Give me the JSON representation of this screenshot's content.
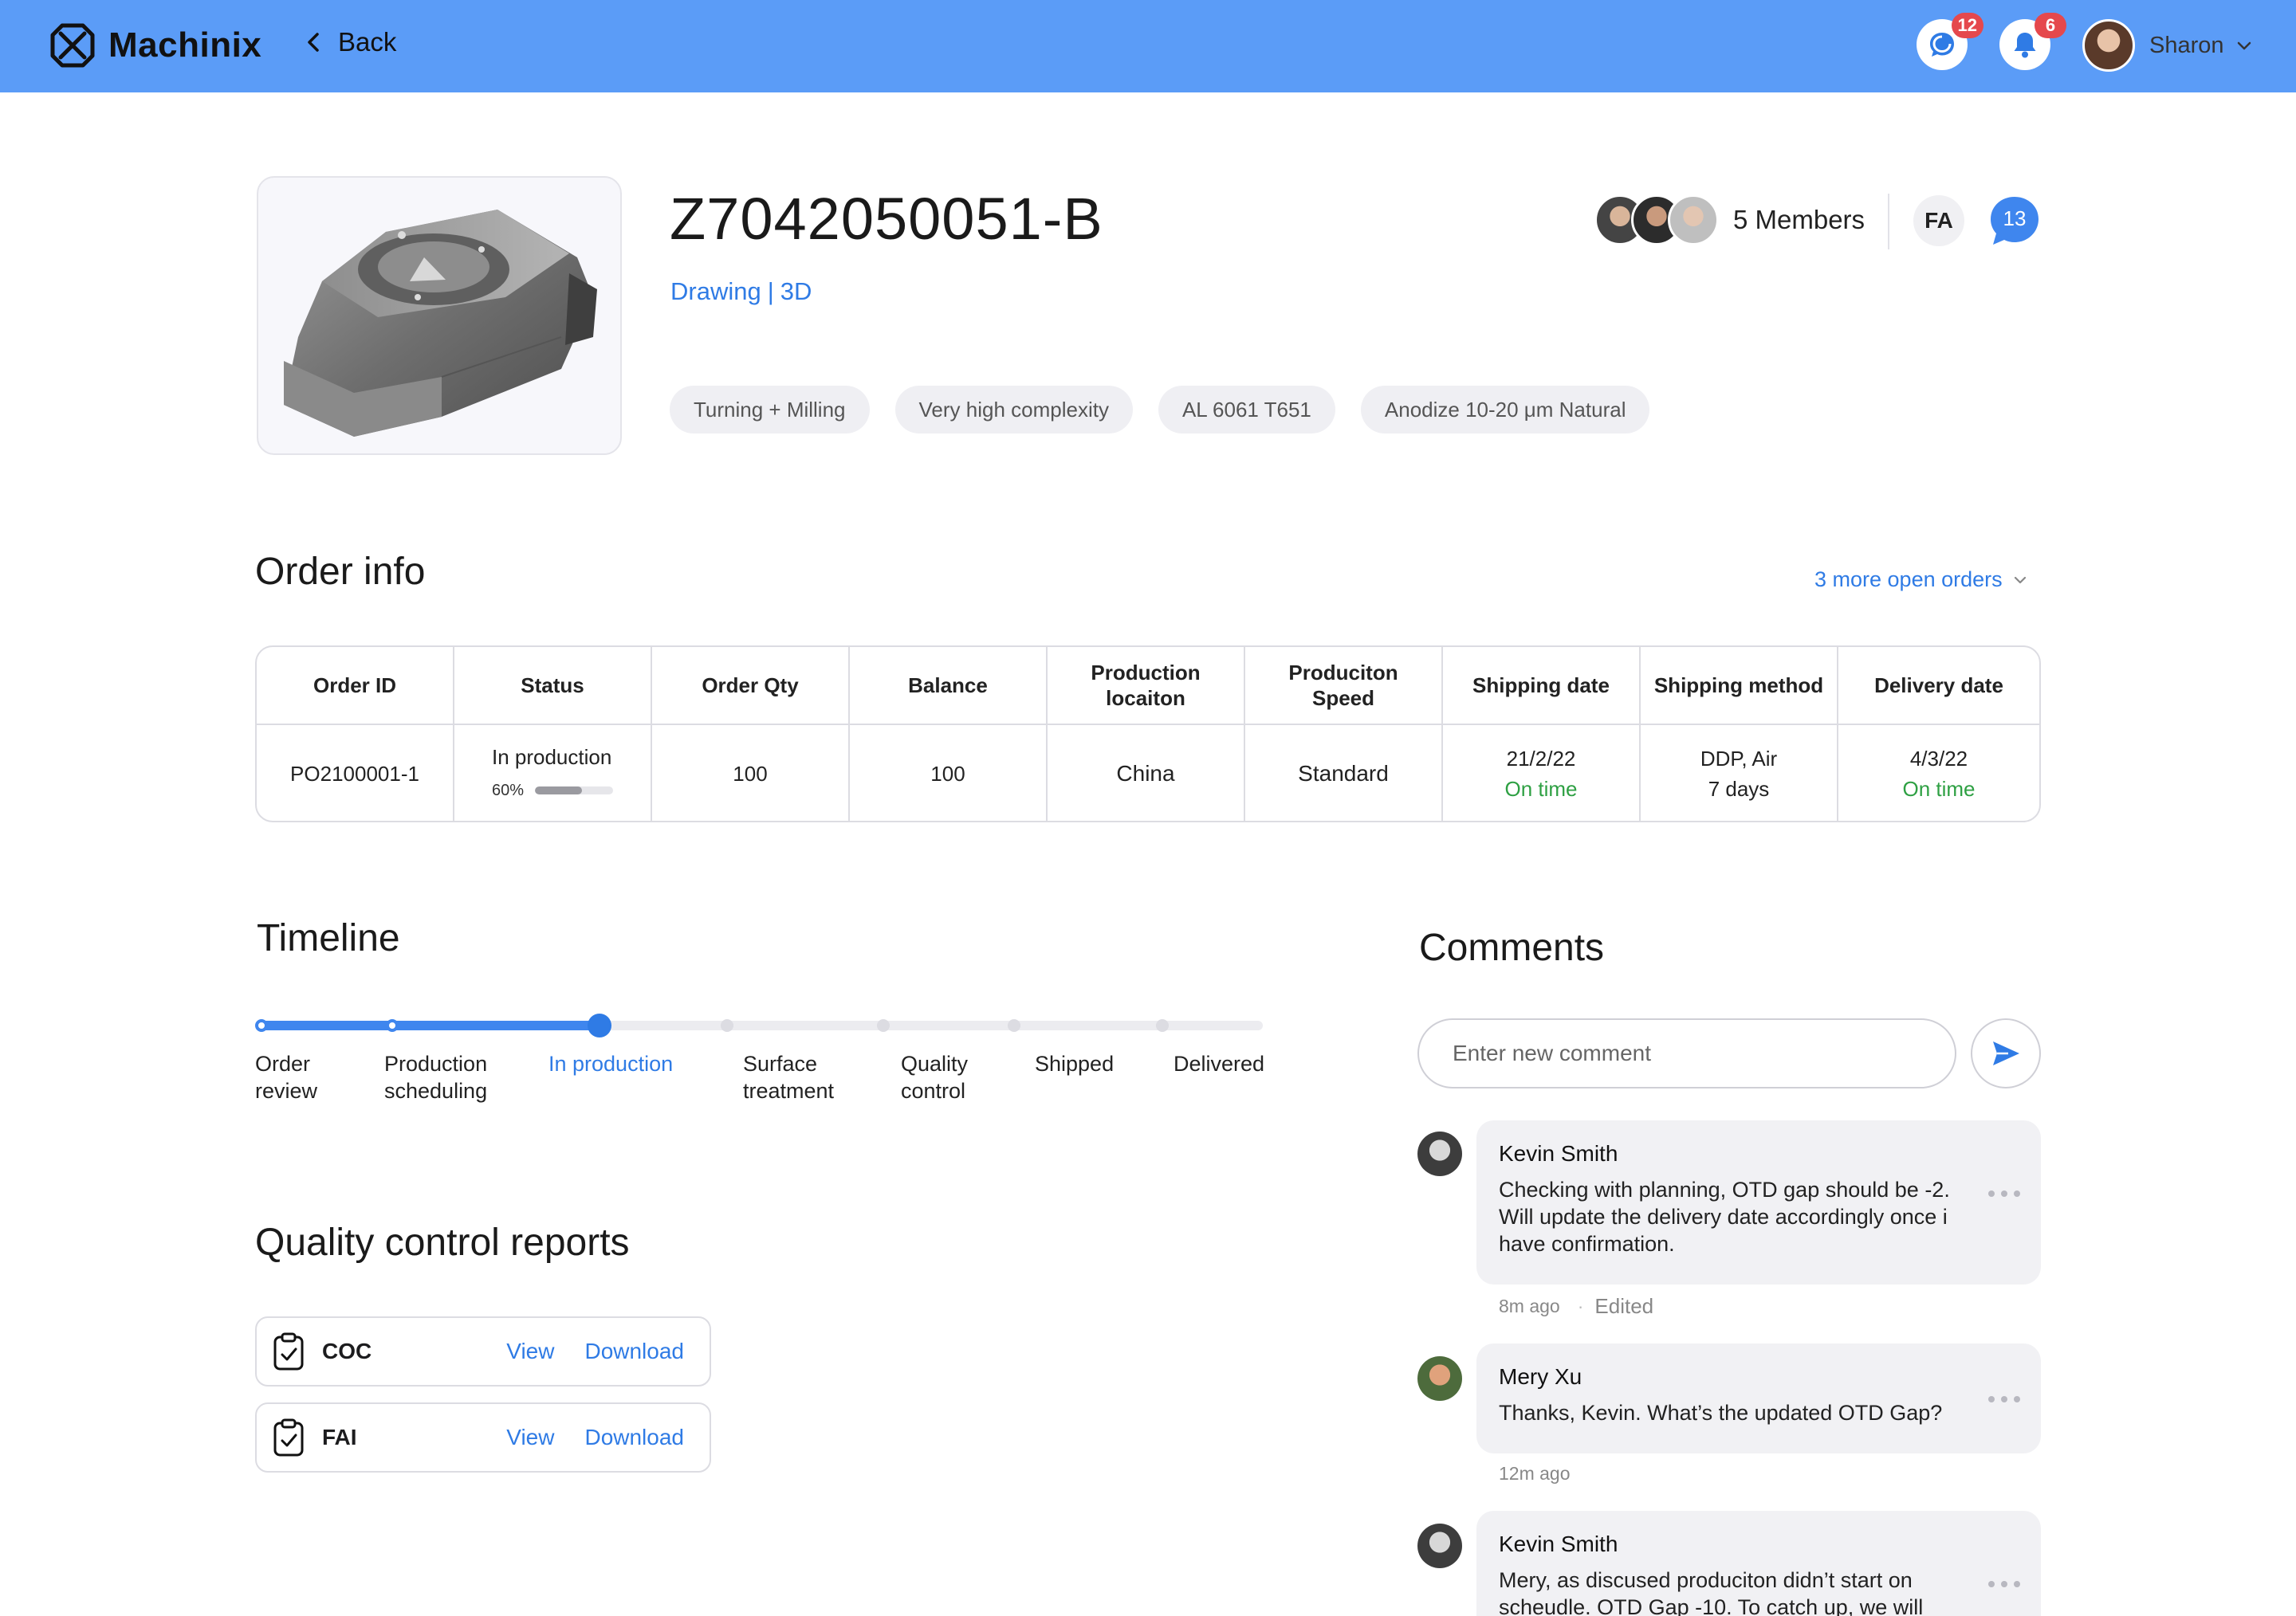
{
  "header": {
    "brand": "Machinix",
    "back_label": "Back",
    "messages_badge": "12",
    "notifications_badge": "6",
    "user_name": "Sharon",
    "brand_color": "#5b9cf7"
  },
  "part": {
    "title": "Z7042050051-B",
    "drawing_link": "Drawing",
    "link_separator": "|",
    "model_link": "3D",
    "tags": [
      "Turning + Milling",
      "Very high complexity",
      "AL 6061 T651",
      "Anodize 10-20 μm Natural"
    ],
    "members_label": "5 Members",
    "fa_label": "FA",
    "comments_count": "13"
  },
  "order_info": {
    "title": "Order info",
    "more_orders": "3 more open orders",
    "columns": [
      "Order ID",
      "Status",
      "Order Qty",
      "Balance",
      "Production\nlocaiton",
      "Produciton\nSpeed",
      "Shipping date",
      "Shipping method",
      "Delivery date"
    ],
    "row": {
      "order_id": "PO2100001-1",
      "status": "In production",
      "progress_label": "60%",
      "progress": 0.6,
      "order_qty": "100",
      "balance": "100",
      "location": "China",
      "speed": "Standard",
      "shipping_date": "21/2/22",
      "shipping_status": "On time",
      "shipping_method": "DDP, Air",
      "shipping_duration": "7 days",
      "delivery_date": "4/3/22",
      "delivery_status": "On time"
    }
  },
  "timeline": {
    "title": "Timeline",
    "current_index": 2,
    "steps": [
      "Order\nreview",
      "Production\nscheduling",
      "In production",
      "Surface\ntreatment",
      "Quality\ncontrol",
      "Shipped",
      "Delivered"
    ]
  },
  "qc_reports": {
    "title": "Quality control reports",
    "items": [
      {
        "name": "COC",
        "view": "View",
        "download": "Download"
      },
      {
        "name": "FAI",
        "view": "View",
        "download": "Download"
      }
    ]
  },
  "comments": {
    "title": "Comments",
    "input_placeholder": "Enter new comment",
    "items": [
      {
        "author": "Kevin Smith",
        "text": "Checking with planning, OTD gap should be -2. Will update the delivery date accordingly once i have confirmation.",
        "time": "8m ago",
        "edited": "Edited"
      },
      {
        "author": "Mery Xu",
        "text": "Thanks, Kevin. What’s the updated OTD Gap?",
        "time": "12m ago"
      },
      {
        "author": "Kevin Smith",
        "text": "Mery, as discused produciton didn’t start on scheudle. OTD Gap -10. To catch up, we will"
      }
    ]
  }
}
